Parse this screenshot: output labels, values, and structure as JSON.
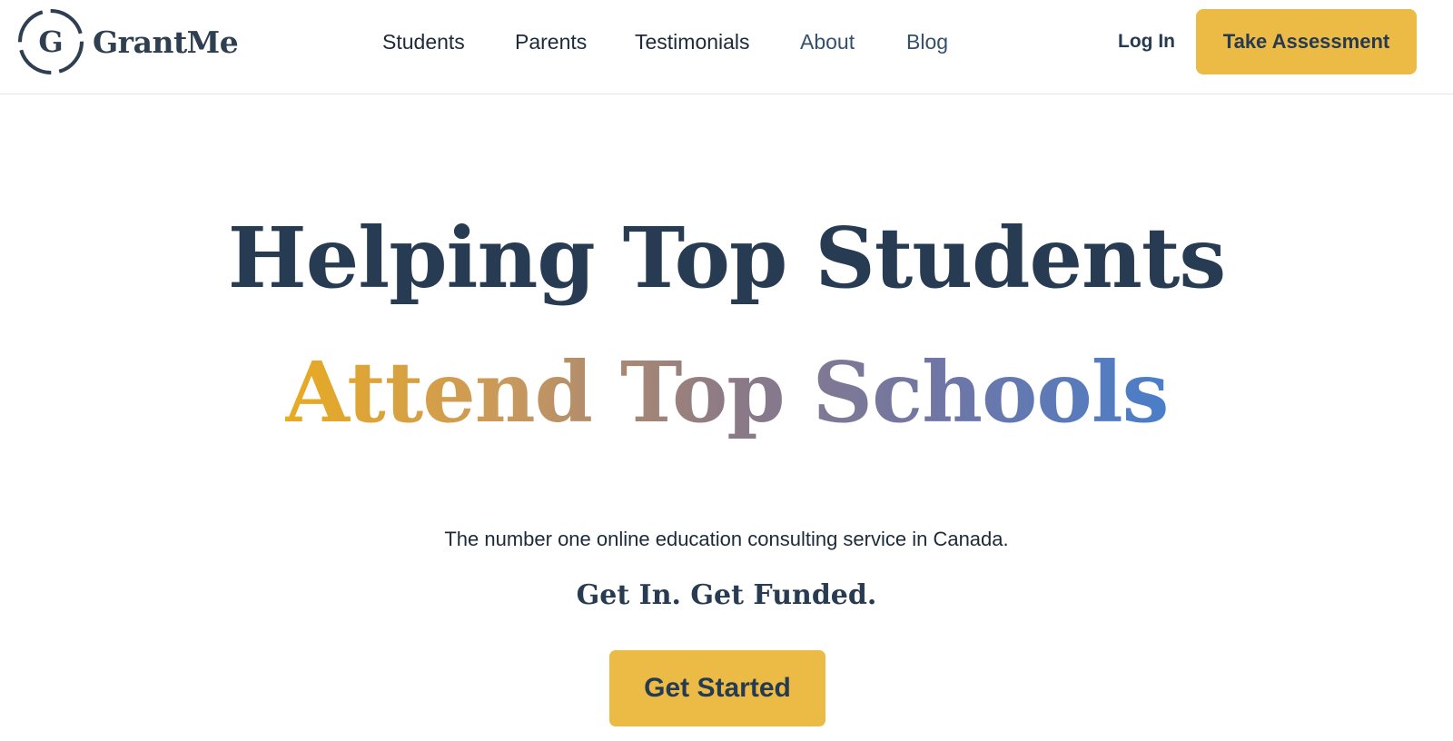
{
  "brand": {
    "name": "GrantMe",
    "logo_letter": "G",
    "primary_color": "#273b52",
    "accent_color": "#ebbb45"
  },
  "nav": {
    "items": [
      {
        "label": "Students"
      },
      {
        "label": "Parents"
      },
      {
        "label": "Testimonials"
      },
      {
        "label": "About"
      },
      {
        "label": "Blog"
      }
    ],
    "login_label": "Log In",
    "cta_label": "Take Assessment"
  },
  "hero": {
    "headline_line1": "Helping Top Students",
    "headline_line2": "Attend Top Schools",
    "gradient_colors": [
      "#e8ab22",
      "#c9995c",
      "#8c7a86",
      "#6f76a6",
      "#4a7ec9"
    ],
    "tagline": "The number one online education consulting service in Canada.",
    "slogan": "Get In. Get Funded.",
    "cta_label": "Get Started"
  }
}
